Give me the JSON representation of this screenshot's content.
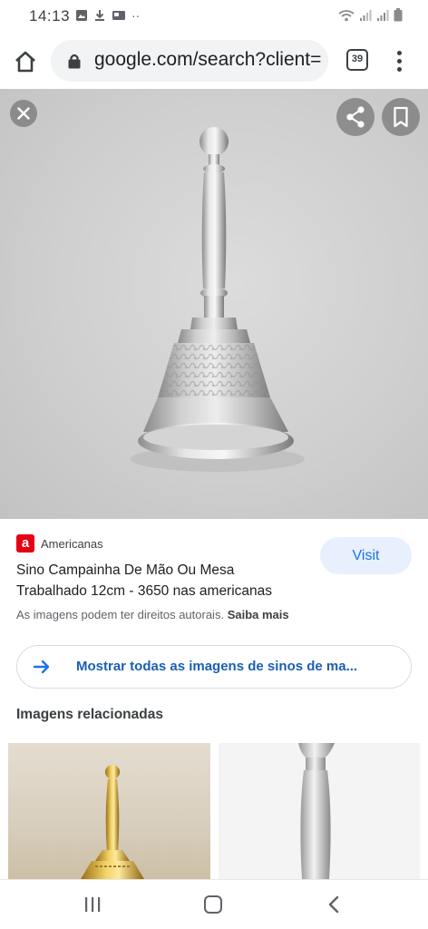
{
  "status_bar": {
    "time": "14:13",
    "dots": "··"
  },
  "browser": {
    "url": "google.com/search?client=",
    "tab_count": "39"
  },
  "result": {
    "source_name": "Americanas",
    "favicon_letter": "a",
    "title": "Sino Campainha De Mão Ou Mesa Trabalhado 12cm - 3650 nas americanas",
    "visit_label": "Visit",
    "rights_notice": "As imagens podem ter direitos autorais.",
    "learn_more": "Saiba mais"
  },
  "show_all": {
    "label": "Mostrar todas as imagens de sinos de ma..."
  },
  "related": {
    "heading": "Imagens relacionadas"
  },
  "icons": {
    "home": "home-icon",
    "lock": "lock-icon",
    "menu": "more-vert-icon",
    "close": "close-icon",
    "share": "share-icon",
    "bookmark": "bookmark-icon",
    "arrow": "arrow-right-icon"
  },
  "colors": {
    "accent": "#1a73e8",
    "visit_bg": "#e8f0fe",
    "favicon": "#e60014"
  }
}
